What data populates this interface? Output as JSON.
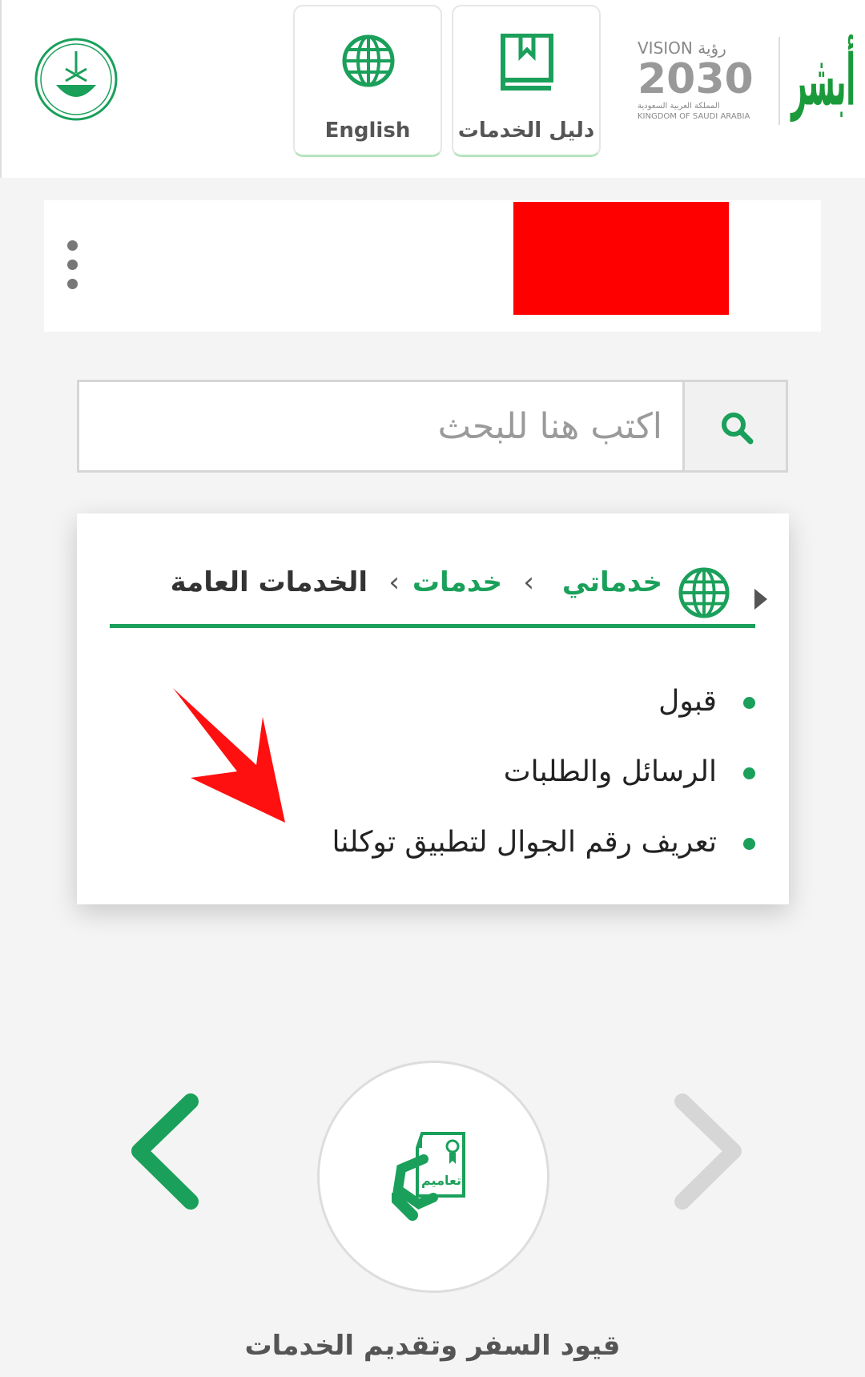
{
  "header": {
    "english_label": "English",
    "services_guide_label": "دليل الخدمات",
    "vision_text": "VISION رؤية 2030",
    "kingdom_text": "المملكة العربية السعودية KINGDOM OF SAUDI ARABIA",
    "absher_logo_text": "أبشر"
  },
  "search": {
    "placeholder": "اكتب هنا للبحث"
  },
  "breadcrumb": [
    "خدماتي",
    "خدمات",
    "الخدمات العامة"
  ],
  "menu_items": [
    "قبول",
    "الرسائل والطلبات",
    "تعريف رقم الجوال لتطبيق توكلنا"
  ],
  "carousel": {
    "icon_text": "تعاميم",
    "caption": "قيود السفر وتقديم الخدمات"
  },
  "colors": {
    "accent": "#1aa05a",
    "redaction": "#ff0000",
    "annotation_arrow": "#ff0000"
  }
}
